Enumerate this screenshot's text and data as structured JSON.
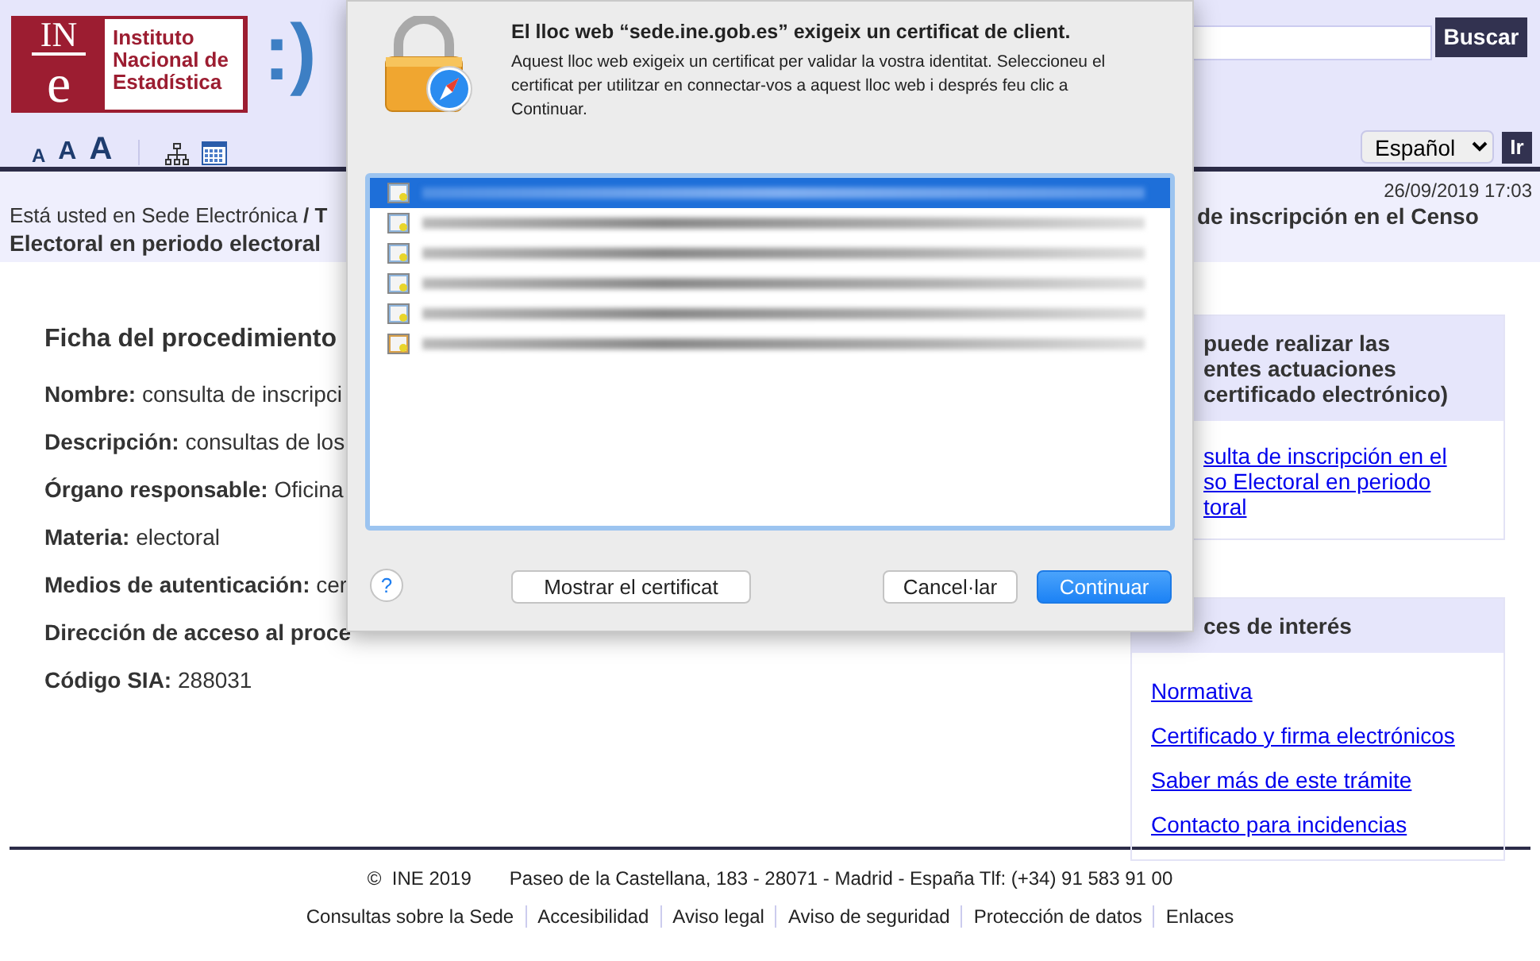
{
  "header": {
    "logo": {
      "mark_top": "IN",
      "mark_bottom": "e",
      "name_lines": [
        "Instituto",
        "Nacional de",
        "Estadística"
      ]
    },
    "smiley": ":)",
    "search": {
      "button": "Buscar"
    },
    "font_size_buttons": [
      "A",
      "A",
      "A"
    ],
    "language": {
      "value": "Español",
      "button": "Ir"
    }
  },
  "breadcrumb": {
    "date": "26/09/2019 17:03",
    "line_1": "Está usted en Sede Electrónica **/ T**",
    "line_2": "Electoral en periodo electoral",
    "line_1_right": "de inscripción en el Censo"
  },
  "procedure": {
    "title": "Ficha del procedimiento",
    "fields": [
      {
        "label": "Nombre:",
        "value": "consulta de inscripci"
      },
      {
        "label": "Descripción:",
        "value": "consultas de los"
      },
      {
        "label": "Órgano responsable:",
        "value": "Oficina"
      },
      {
        "label": "Materia:",
        "value": "electoral"
      },
      {
        "label": "Medios de autenticación:",
        "value": "cer"
      },
      {
        "label": "Dirección de acceso al proce"
      },
      {
        "label": "Código SIA:",
        "value": "288031"
      }
    ]
  },
  "sidebar": {
    "actions_box": {
      "heading_lines": [
        "puede realizar las",
        "entes actuaciones",
        "certificado electrónico)"
      ],
      "link_lines": [
        "sulta de inscripción en el",
        "so Electoral en periodo",
        "toral"
      ]
    },
    "links_box": {
      "heading": "ces de interés",
      "links": [
        "Normativa",
        "Certificado y firma electrónicos",
        "Saber más de este trámite",
        "Contacto para incidencias"
      ]
    }
  },
  "footer": {
    "copyright": "©  INE 2019",
    "address": "Paseo de la Castellana, 183 - 28071 - Madrid - España Tlf: (+34) 91 583 91 00",
    "links": [
      "Consultas sobre la Sede",
      "Accesibilidad",
      "Aviso legal",
      "Aviso de seguridad",
      "Protección de datos",
      "Enlaces"
    ]
  },
  "dialog": {
    "title": "El lloc web “sede.ine.gob.es” exigeix un certificat de client.",
    "message": "Aquest lloc web exigeix un certificat per validar la vostra identitat. Seleccioneu el certificat per utilitzar en connectar-vos a aquest lloc web i després feu clic a Continuar.",
    "certificates": [
      {
        "selected": true,
        "color": "#8fb6de"
      },
      {
        "selected": false,
        "color": "#8fb6de"
      },
      {
        "selected": false,
        "color": "#8fb6de"
      },
      {
        "selected": false,
        "color": "#8fb6de"
      },
      {
        "selected": false,
        "color": "#8fb6de"
      },
      {
        "selected": false,
        "color": "#d9a048"
      }
    ],
    "help": "?",
    "show_button": "Mostrar el certificat",
    "cancel_button": "Cancel·lar",
    "continue_button": "Continuar"
  }
}
